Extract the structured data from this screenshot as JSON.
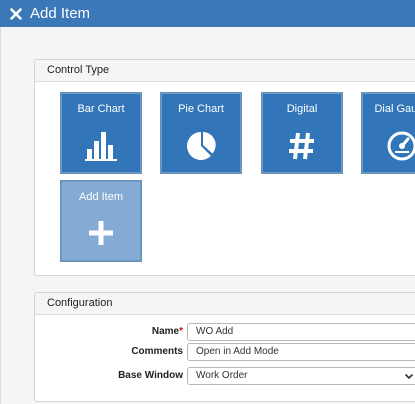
{
  "window": {
    "title": "Add Item",
    "close_icon": "close-icon"
  },
  "control_type": {
    "heading": "Control Type",
    "tiles": [
      {
        "label": "Bar Chart",
        "icon": "bar-chart-icon"
      },
      {
        "label": "Pie Chart",
        "icon": "pie-chart-icon"
      },
      {
        "label": "Digital",
        "icon": "hashtag-icon"
      },
      {
        "label": "Dial Gauge",
        "icon": "dial-gauge-icon"
      },
      {
        "label": "Add Item",
        "icon": "plus-icon"
      }
    ]
  },
  "configuration": {
    "heading": "Configuration",
    "fields": {
      "name": {
        "label": "Name",
        "required_marker": "*",
        "value": "WO Add"
      },
      "comments": {
        "label": "Comments",
        "value": "Open in Add Mode"
      },
      "base_window": {
        "label": "Base Window",
        "value": "Work Order"
      }
    }
  },
  "colors": {
    "title_bar": "#3a78b8",
    "tile": "#3276b9",
    "tile_selected": "#85aad3",
    "required": "#cc1111"
  }
}
